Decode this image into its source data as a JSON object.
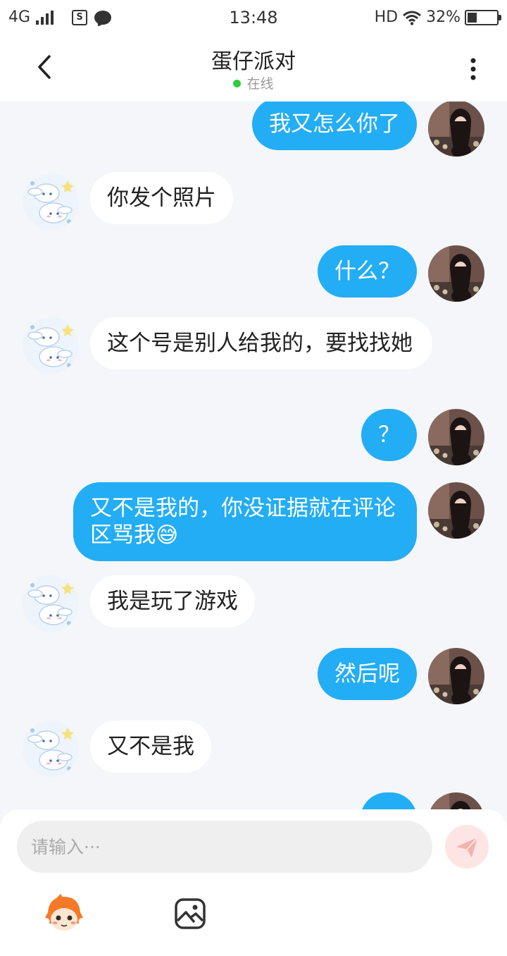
{
  "status_bar": {
    "network": "4G",
    "time": "13:48",
    "hd": "HD",
    "battery": "32%",
    "battery_level": 0.32
  },
  "header": {
    "title": "蛋仔派对",
    "status": "在线"
  },
  "messages": [
    {
      "side": "me",
      "text": "我又怎么你了"
    },
    {
      "side": "other",
      "text": "你发个照片"
    },
    {
      "side": "me",
      "text": "什么？"
    },
    {
      "side": "other",
      "text": "这个号是别人给我的，要找找她"
    },
    {
      "side": "me",
      "text": "？"
    },
    {
      "side": "me",
      "text": "又不是我的，你没证据就在评论区骂我😅"
    },
    {
      "side": "other",
      "text": "我是玩了游戏"
    },
    {
      "side": "me",
      "text": "然后呢"
    },
    {
      "side": "other",
      "text": "又不是我"
    }
  ],
  "input": {
    "placeholder": "请输入···"
  },
  "colors": {
    "accent_blue": "#23adf4",
    "background": "#f4f6f9",
    "online_green": "#2ecc40"
  },
  "icons": {
    "back": "chevron-left-icon",
    "more": "more-vertical-icon",
    "send": "paper-plane-icon",
    "mascot": "eggy-mascot-icon",
    "image": "image-icon"
  }
}
